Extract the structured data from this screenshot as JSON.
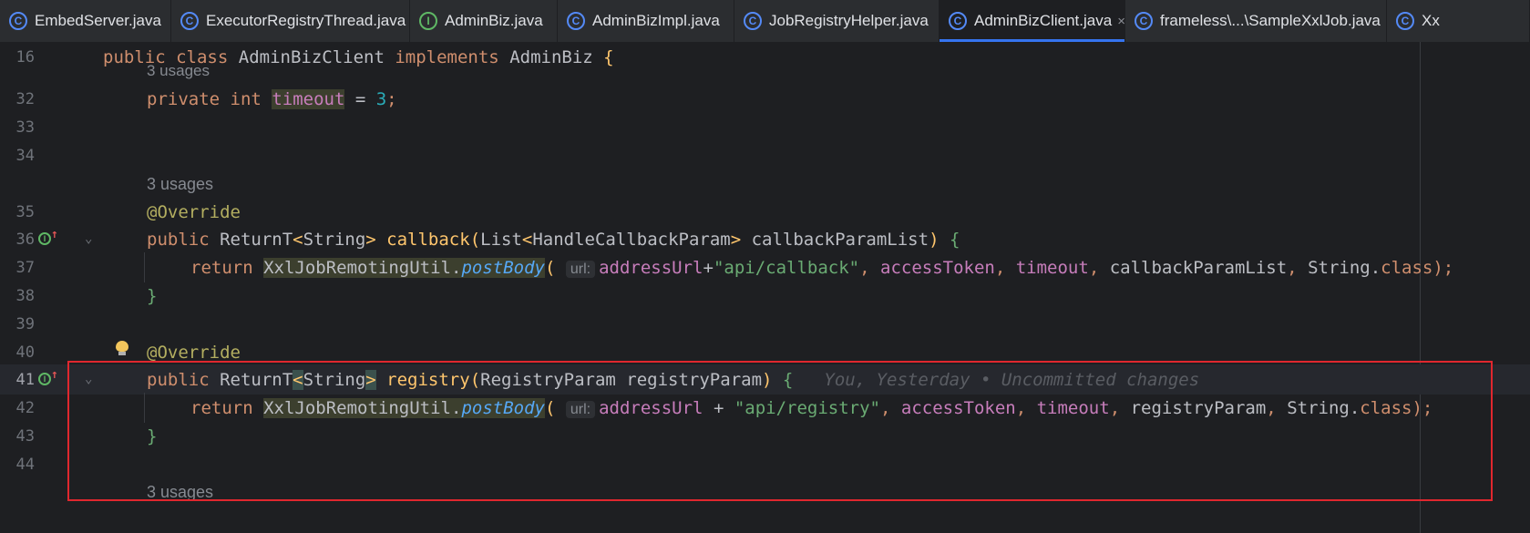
{
  "tabs": [
    {
      "label": "EmbedServer.java",
      "icon": "C"
    },
    {
      "label": "ExecutorRegistryThread.java",
      "icon": "C"
    },
    {
      "label": "AdminBiz.java",
      "icon": "I"
    },
    {
      "label": "AdminBizImpl.java",
      "icon": "C"
    },
    {
      "label": "JobRegistryHelper.java",
      "icon": "C"
    },
    {
      "label": "AdminBizClient.java",
      "icon": "C",
      "active": true,
      "close": "×"
    },
    {
      "label": "frameless\\...\\SampleXxlJob.java",
      "icon": "C"
    },
    {
      "label": "Xx",
      "icon": "C"
    }
  ],
  "editor": {
    "sticky_line": {
      "num": "16",
      "public": "public",
      "class": "class",
      "name": "AdminBizClient",
      "implements": "implements",
      "iface": "AdminBiz",
      "brace": "{"
    },
    "usages_3": "3 usages",
    "lines": {
      "l32": {
        "num": "32",
        "private": "private",
        "int": "int",
        "field": "timeout",
        "eq": " = ",
        "val": "3",
        "semi": ";"
      },
      "l33": {
        "num": "33"
      },
      "l34": {
        "num": "34"
      },
      "l35": {
        "num": "35",
        "annotation": "@Override"
      },
      "l36": {
        "num": "36",
        "public": "public",
        "type": "ReturnT",
        "generic_open": "<",
        "generic_type": "String",
        "generic_close": ">",
        "method": "callback",
        "paren_open": "(",
        "ptype": "List",
        "pg_open": "<",
        "pg_type": "HandleCallbackParam",
        "pg_close": ">",
        "pname": " callbackParamList",
        "paren_close": ")",
        "brace": "{"
      },
      "l37": {
        "num": "37",
        "return": "return",
        "util": "XxlJobRemotingUtil",
        "dot": ".",
        "method": "postBody",
        "paren": "(",
        "hint": "url:",
        "arg1": "addressUrl",
        "plus": "+",
        "str": "\"api/callback\"",
        "c1": ", ",
        "arg2": "accessToken",
        "c2": ", ",
        "arg3": "timeout",
        "c3": ", ",
        "arg4": "callbackParamList",
        "c4": ", ",
        "arg5": "String",
        "dot2": ".",
        "cls": "class",
        "end": ");"
      },
      "l38": {
        "num": "38",
        "brace": "}"
      },
      "l39": {
        "num": "39"
      },
      "l40": {
        "num": "40",
        "annotation": "@Override"
      },
      "l41": {
        "num": "41",
        "public": "public",
        "type": "ReturnT",
        "generic_open": "<",
        "generic_type": "String",
        "generic_close": ">",
        "method": "registry",
        "paren_open": "(",
        "ptype": "RegistryParam",
        "pname": " registryParam",
        "paren_close": ")",
        "brace": "{",
        "blame": "You, Yesterday • Uncommitted changes"
      },
      "l42": {
        "num": "42",
        "return": "return",
        "util": "XxlJobRemotingUtil",
        "dot": ".",
        "method": "postBody",
        "paren": "(",
        "hint": "url:",
        "arg1": "addressUrl",
        "plus": " + ",
        "str": "\"api/registry\"",
        "c1": ", ",
        "arg2": "accessToken",
        "c2": ", ",
        "arg3": "timeout",
        "c3": ", ",
        "arg4": "registryParam",
        "c4": ", ",
        "arg5": "String",
        "dot2": ".",
        "cls": "class",
        "end": ");"
      },
      "l43": {
        "num": "43",
        "brace": "}"
      },
      "l44": {
        "num": "44"
      }
    }
  },
  "colors": {
    "highlight_box": "#e0272e",
    "active_tab_underline": "#3574f0"
  }
}
